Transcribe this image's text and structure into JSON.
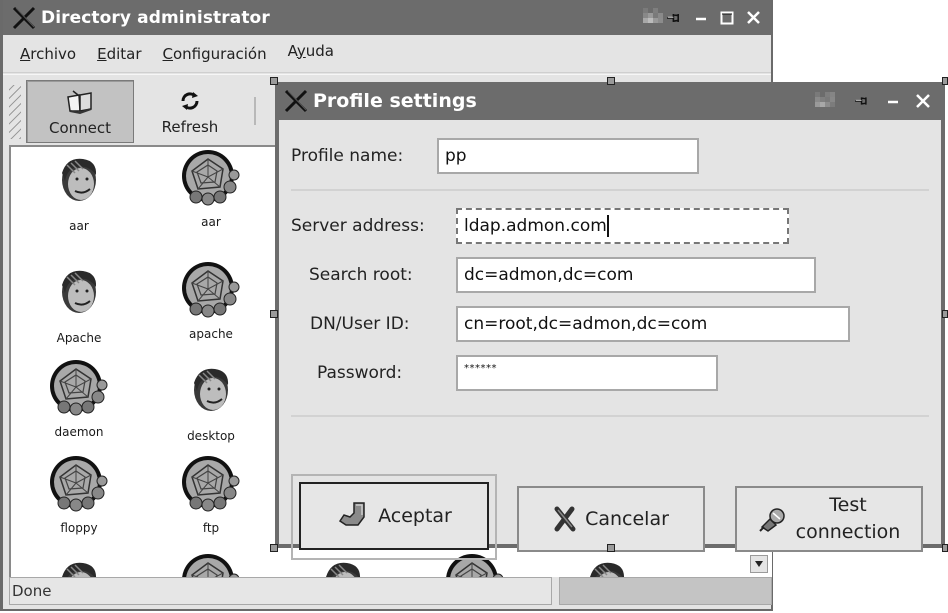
{
  "main_window": {
    "title": "Directory administrator",
    "titlebar_buttons": [
      "pin",
      "minimize",
      "maximize",
      "close"
    ],
    "menu": [
      {
        "label": "Archivo",
        "mnemonic": "A",
        "rest": "rchivo"
      },
      {
        "label": "Editar",
        "mnemonic": "E",
        "rest": "ditar"
      },
      {
        "label": "Configuración",
        "mnemonic": "C",
        "rest": "onfiguración"
      },
      {
        "label": "Ayuda",
        "mnemonic_pre": "A",
        "mnemonic": "y",
        "rest": "uda"
      }
    ],
    "toolbar": {
      "connect_label": "Connect",
      "refresh_label": "Refresh"
    },
    "entries": [
      {
        "name": "aar",
        "icon": "user-face"
      },
      {
        "name": "aar",
        "icon": "group-web"
      },
      {
        "name": "Apache",
        "icon": "user-face"
      },
      {
        "name": "apache",
        "icon": "group-web"
      },
      {
        "name": "daemon",
        "icon": "group-web"
      },
      {
        "name": "desktop",
        "icon": "user-face"
      },
      {
        "name": "floppy",
        "icon": "group-web"
      },
      {
        "name": "ftp",
        "icon": "group-web"
      }
    ],
    "partial_row_icons": [
      "user-face",
      "group-web",
      "user-face",
      "group-web",
      "user-face"
    ],
    "status_text": "Done"
  },
  "dialog": {
    "title": "Profile settings",
    "titlebar_buttons": [
      "pin",
      "minimize",
      "close"
    ],
    "fields": {
      "profile_name": {
        "label": "Profile name:",
        "value": "pp"
      },
      "server_address": {
        "label": "Server address:",
        "value": "ldap.admon.com"
      },
      "search_root": {
        "label": "Search root:",
        "value": "dc=admon,dc=com"
      },
      "dn_user_id": {
        "label": "DN/User ID:",
        "value": "cn=root,dc=admon,dc=com"
      },
      "password": {
        "label": "Password:",
        "value": "******"
      }
    },
    "buttons": {
      "accept": "Aceptar",
      "cancel": "Cancelar",
      "test_line1": "Test",
      "test_line2": "connection"
    }
  },
  "colors": {
    "titlebar": "#6c6c6c",
    "window_bg": "#e4e4e4",
    "content_bg": "#ffffff"
  }
}
